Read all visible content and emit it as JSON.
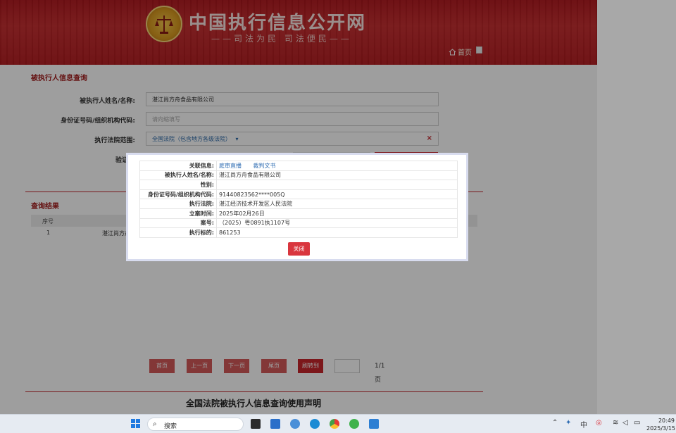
{
  "header": {
    "site_title": "中国执行信息公开网",
    "slogan": "——司法为民 司法便民——",
    "home_label": "首页"
  },
  "search_form": {
    "section_title": "被执行人信息查询",
    "name_label": "被执行人姓名/名称:",
    "name_value": "湛江尚方舟食品有限公司",
    "id_label": "身份证号码/组织机构代码:",
    "id_placeholder": "请向缩填写",
    "court_label": "执行法院范围:",
    "court_value": "全国法院（包含地方各级法院）",
    "court_dropdown": "▾",
    "court_clear": "×",
    "captcha_label_partial": "验证"
  },
  "results": {
    "title": "查询结果",
    "columns": [
      "序号"
    ],
    "rows": [
      {
        "index": "1",
        "name_partial": "湛江尚方舟"
      }
    ]
  },
  "pager": {
    "first": "首页",
    "prev": "上一页",
    "next": "下一页",
    "last": "尾页",
    "jump": "刷转到",
    "info": "1/1页"
  },
  "footer": {
    "title": "全国法院被执行人信息查询使用声明"
  },
  "modal": {
    "rows": [
      {
        "key": "关联信息:",
        "links": [
          "庭审直播",
          "裁判文书"
        ]
      },
      {
        "key": "被执行人姓名/名称:",
        "value": "湛江尚方舟食品有限公司"
      },
      {
        "key": "性别:",
        "value": ""
      },
      {
        "key": "身份证号码/组织机构代码:",
        "value": "91440823562****005Q"
      },
      {
        "key": "执行法院:",
        "value": "湛江经济技术开发区人民法院"
      },
      {
        "key": "立案时间:",
        "value": "2025年02月26日"
      },
      {
        "key": "案号:",
        "value": "（2025）粤0891执1107号"
      },
      {
        "key": "执行标的:",
        "value": "861253"
      }
    ],
    "close_label": "关闭"
  },
  "taskbar": {
    "search_label": "搜索",
    "ime": "中",
    "time": "20:49",
    "date": "2025/3/15"
  },
  "colors": {
    "brand_red": "#b1171d",
    "button_red": "#d9363e",
    "link_blue": "#2f6db3"
  }
}
